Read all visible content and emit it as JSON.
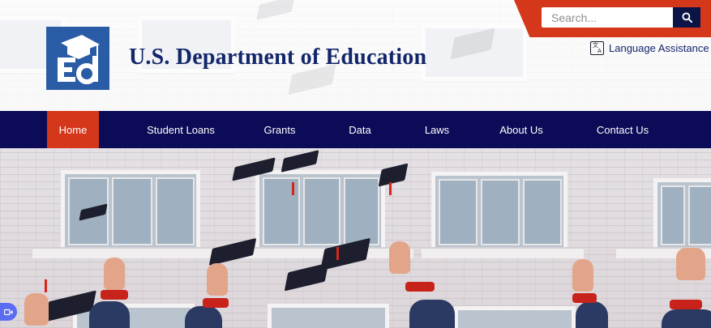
{
  "header": {
    "site_title": "U.S. Department of Education",
    "logo_icon": "ed-logo-graduation-cap",
    "brand_blue": "#2a5ca6",
    "title_color": "#12266b"
  },
  "search": {
    "placeholder": "Search...",
    "button_icon": "search-icon",
    "band_color": "#d5371b"
  },
  "language": {
    "label": "Language Assistance",
    "icon": "translate-icon"
  },
  "nav": {
    "background": "#0b0b58",
    "active_color": "#d5371b",
    "items": [
      {
        "label": "Home",
        "active": true
      },
      {
        "label": "Student Loans",
        "active": false
      },
      {
        "label": "Grants",
        "active": false
      },
      {
        "label": "Data",
        "active": false
      },
      {
        "label": "Laws",
        "active": false
      },
      {
        "label": "About Us",
        "active": false
      },
      {
        "label": "Contact Us",
        "active": false
      }
    ]
  },
  "hero": {
    "image_subject": "graduation caps thrown in the air"
  },
  "chat_widget": {
    "icon": "video-call-icon"
  }
}
